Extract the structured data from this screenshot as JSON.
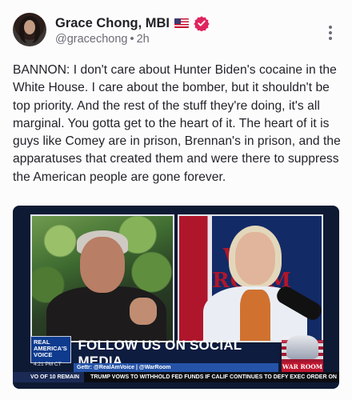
{
  "post": {
    "author": {
      "display_name": "Grace Chong, MBI",
      "handle": "@gracechong",
      "time_ago": "2h",
      "verified": true
    },
    "text": "BANNON: I don't care about Hunter Biden's cocaine in the White House. I care about the bomber, but it shouldn't be top priority. And the rest of the stuff they're doing, it's all marginal. You gotta get to the heart of it. The heart of it is guys like Comey are in prison, Brennan's in prison, and the apparatuses that created them and were there to suppress the American people are gone forever."
  },
  "media": {
    "banner_text": "WAR ROOM",
    "lower_third": {
      "logo_text": "REAL AMERICA'S VOICE",
      "time": "4:21 PM CT",
      "headline": "FOLLOW US ON SOCIAL MEDIA",
      "subline": "Gettr: @RealAmVoice | @WarRoom"
    },
    "show_logo": "WAR ROOM",
    "ticker": {
      "count": "VO OF 10 REMAIN",
      "news": "TRUMP VOWS TO WITHHOLD FED FUNDS IF CALIF CONTINUES TO DEFY EXEC ORDER ON"
    }
  },
  "icons": {
    "flag": "us-flag-icon",
    "verified": "verified-badge-icon",
    "more": "more-options-icon"
  },
  "colors": {
    "verified": "#e0245e",
    "text": "#232229",
    "muted": "#6e6b76"
  }
}
